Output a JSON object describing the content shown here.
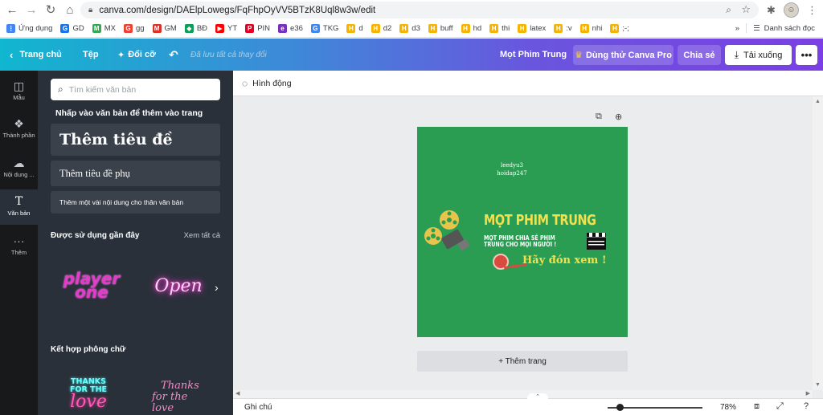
{
  "browser": {
    "url": "canva.com/design/DAElpLowegs/FqFhpOyVV5BTzK8Uql8w3w/edit"
  },
  "bookmarks": {
    "items": [
      {
        "label": "Ứng dụng",
        "color": "#4285f4",
        "glyph": "⋮"
      },
      {
        "label": "GD",
        "color": "#1a73e8",
        "glyph": "G"
      },
      {
        "label": "MX",
        "color": "#34a853",
        "glyph": "M"
      },
      {
        "label": "gg",
        "color": "#ea4335",
        "glyph": "G"
      },
      {
        "label": "GM",
        "color": "#d93025",
        "glyph": "M"
      },
      {
        "label": "BĐ",
        "color": "#0f9d58",
        "glyph": "◆"
      },
      {
        "label": "YT",
        "color": "#ff0000",
        "glyph": "▶"
      },
      {
        "label": "PIN",
        "color": "#e60023",
        "glyph": "P"
      },
      {
        "label": "e36",
        "color": "#7b2fbe",
        "glyph": "e"
      },
      {
        "label": "TKG",
        "color": "#4285f4",
        "glyph": "G"
      },
      {
        "label": "d",
        "color": "#f4b400",
        "glyph": "H"
      },
      {
        "label": "d2",
        "color": "#f4b400",
        "glyph": "H"
      },
      {
        "label": "d3",
        "color": "#f4b400",
        "glyph": "H"
      },
      {
        "label": "buff",
        "color": "#f4b400",
        "glyph": "H"
      },
      {
        "label": "hd",
        "color": "#f4b400",
        "glyph": "H"
      },
      {
        "label": "thi",
        "color": "#f4b400",
        "glyph": "H"
      },
      {
        "label": "latex",
        "color": "#f4b400",
        "glyph": "H"
      },
      {
        "label": ":v",
        "color": "#f4b400",
        "glyph": "H"
      },
      {
        "label": "nhi",
        "color": "#f4b400",
        "glyph": "H"
      },
      {
        "label": ";-;",
        "color": "#f4b400",
        "glyph": "H"
      }
    ],
    "more": "»",
    "reading_list": "Danh sách đọc"
  },
  "toolbar": {
    "home": "Trang chủ",
    "file": "Tệp",
    "resize": "Đổi cỡ",
    "saved": "Đã lưu tất cả thay đổi",
    "design_title": "Mọt Phim Trung",
    "try_pro": "Dùng thử Canva Pro",
    "share": "Chia sẻ",
    "download": "Tải xuống",
    "more": "•••"
  },
  "rail": {
    "templates": "Mẫu",
    "elements": "Thành phần",
    "uploads": "Nội dung ...",
    "text": "Văn bản",
    "more": "Thêm"
  },
  "panel": {
    "search_placeholder": "Tìm kiếm văn bản",
    "hint": "Nhấp vào văn bản để thêm vào trang",
    "add_heading": "Thêm tiêu đề",
    "add_subheading": "Thêm tiêu đề phụ",
    "add_body": "Thêm một vài nội dung cho thân văn bản",
    "recent_title": "Được sử dụng gần đây",
    "see_all": "Xem tất cả",
    "combos_title": "Kết hợp phông chữ",
    "thumb_player_1": "player",
    "thumb_player_2": "one",
    "thumb_open": "Open",
    "thumb_thanks_1": "THANKS",
    "thumb_thanks_2": "FOR THE",
    "thumb_thanks_3": "love",
    "thumb_thanks_b1": "Thanks",
    "thumb_thanks_b2": "for the love"
  },
  "workspace": {
    "animate": "Hình động",
    "add_page": "+ Thêm trang",
    "notes": "Ghi chú",
    "zoom": "78%",
    "zoom_level": 0.1
  },
  "design": {
    "watermark_1": "leedyu3",
    "watermark_2": "hoidap247",
    "title": "MỌT PHIM TRUNG",
    "subtitle": "MỌT PHIM CHIA SẺ PHIM TRUNG CHO MỌI NGƯỜI !",
    "welcome": "Hãy đón xem !",
    "bg_color": "#2a9d52",
    "accent_color": "#f4e04c"
  }
}
